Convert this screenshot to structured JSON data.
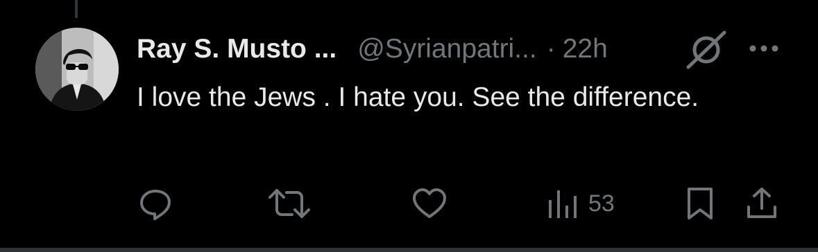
{
  "tweet": {
    "author_name": "Ray S. Musto ...",
    "handle": "@Syrianpatri...",
    "separator": "·",
    "time": "22h",
    "text": "I love the Jews . I hate you. See the difference."
  },
  "actions": {
    "views_count": "53"
  },
  "icons": {
    "avatar": "profile-photo",
    "grok": "grok-icon",
    "more": "more-icon",
    "reply": "reply-icon",
    "retweet": "retweet-icon",
    "like": "heart-icon",
    "views": "views-icon",
    "bookmark": "bookmark-icon",
    "share": "share-icon"
  },
  "colors": {
    "background": "#000000",
    "primary_text": "#e7e9ea",
    "secondary_text": "#71767b",
    "divider": "#2f3336"
  }
}
